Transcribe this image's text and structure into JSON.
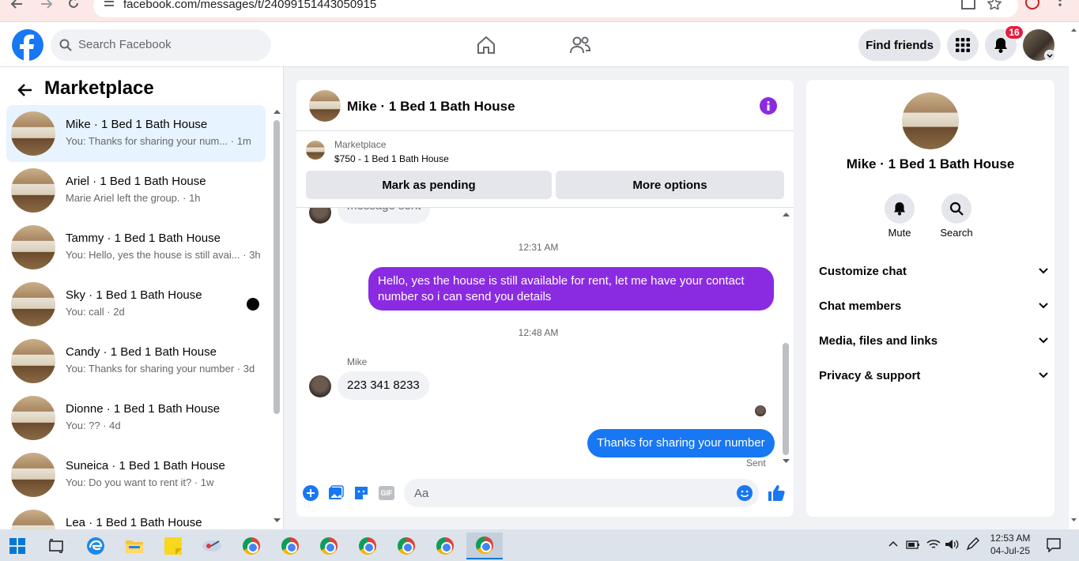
{
  "browser": {
    "url": "facebook.com/messages/t/24099151443050915"
  },
  "header": {
    "search_placeholder": "Search Facebook",
    "find_friends": "Find friends",
    "notifications_count": "16"
  },
  "marketplace": {
    "title": "Marketplace",
    "conversations": [
      {
        "name": "Mike · 1 Bed 1 Bath House",
        "preview": "You: Thanks for sharing your num... · 1m"
      },
      {
        "name": "Ariel · 1 Bed 1 Bath House",
        "preview": "Marie Ariel left the group. · 1h"
      },
      {
        "name": "Tammy · 1 Bed 1 Bath House",
        "preview": "You: Hello, yes the house is still avai... · 3h"
      },
      {
        "name": "Sky · 1 Bed 1 Bath House",
        "preview": "You: call · 2d"
      },
      {
        "name": "Candy · 1 Bed 1 Bath House",
        "preview": "You: Thanks for sharing your number · 3d"
      },
      {
        "name": "Dionne · 1 Bed 1 Bath House",
        "preview": "You: ?? · 4d"
      },
      {
        "name": "Suneica · 1 Bed 1 Bath House",
        "preview": "You: Do you want to rent it? · 1w"
      },
      {
        "name": "Lea · 1 Bed 1 Bath House",
        "preview": ""
      }
    ]
  },
  "chat": {
    "title": "Mike · 1 Bed 1 Bath House",
    "listing_label": "Marketplace",
    "listing_title": "$750 - 1 Bed 1 Bath House",
    "mark_pending": "Mark as pending",
    "more_options": "More options",
    "partial_message": "message sent",
    "time1": "12:31 AM",
    "msg_out1": "Hello, yes the house is still available for rent, let me have your contact number so i can send you  details",
    "time2": "12:48 AM",
    "sender": "Mike",
    "msg_in1": "223 341 8233",
    "msg_out2": "Thanks for sharing your number",
    "status": "Sent",
    "input_placeholder": "Aa"
  },
  "info": {
    "name": "Mike · 1 Bed 1 Bath House",
    "mute": "Mute",
    "search": "Search",
    "sections": [
      "Customize chat",
      "Chat members",
      "Media, files and links",
      "Privacy & support"
    ]
  },
  "taskbar": {
    "time": "12:53 AM",
    "date": "04-Jul-25"
  },
  "colors": {
    "fb_blue": "#1877f2",
    "purple": "#8a2be2",
    "badge_red": "#e41e3f"
  }
}
